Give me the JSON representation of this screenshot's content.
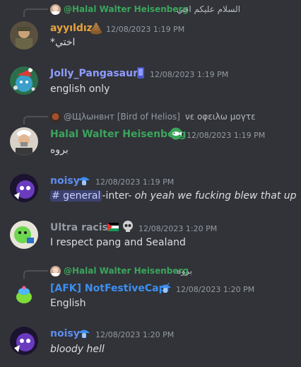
{
  "colors": {
    "background": "#313338",
    "timestamp": "#949ba4",
    "text": "#dbdee1",
    "halal_green": "#3ba55c",
    "ayyildiz_orange": "#e8a33d",
    "jolly_blue": "#8e9cff",
    "noisy_blue": "#5e8cf0",
    "ultra_gray": "#949ba4",
    "afk_blue": "#3d8ff2",
    "mention_bg": "#3c4270"
  },
  "messages": [
    {
      "reply": {
        "name": "@Halal Walter Heisenberg",
        "text": "السلام عليكم اخي"
      },
      "username": "ayyıldız",
      "timestamp": "12/08/2023 1:19 PM",
      "content": "*اختي"
    },
    {
      "username": "Jolly_Pangasaur",
      "timestamp": "12/08/2023 1:19 PM",
      "content": "english only"
    },
    {
      "reply": {
        "name": "@Щλωнвнт [Bird of Helios]",
        "text": "νε οφειλω μογτε"
      },
      "username": "Halal Walter Heisenberg",
      "timestamp": "12/08/2023 1:19 PM",
      "content": "بروه"
    },
    {
      "username": "noisy",
      "timestamp": "12/08/2023 1:19 PM",
      "channel_mention": "# general",
      "content_after": "-inter-",
      "content_italic": "oh yeah we fucking blew that up"
    },
    {
      "username": "Ultra racist",
      "timestamp": "12/08/2023 1:20 PM",
      "content": "I respect pang and Sealand"
    },
    {
      "reply": {
        "name": "@Halal Walter Heisenberg",
        "text": "بروه"
      },
      "username": "[AFK] NotFestiveCapí",
      "timestamp": "12/08/2023 1:20 PM",
      "content": "English"
    },
    {
      "username": "noisy",
      "timestamp": "12/08/2023 1:20 PM",
      "content": "bloody hell"
    }
  ]
}
